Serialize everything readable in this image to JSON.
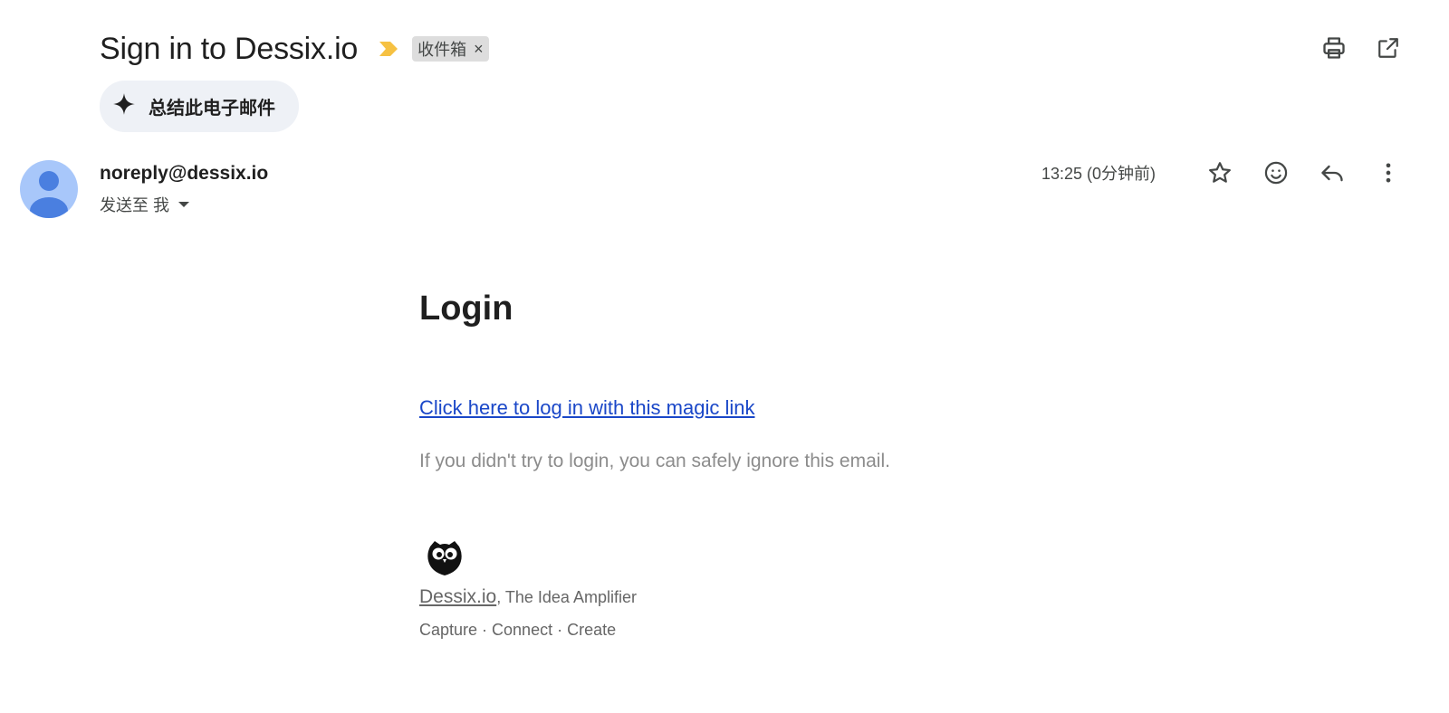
{
  "email": {
    "subject": "Sign in to Dessix.io",
    "label_chip": "收件箱",
    "label_close": "×",
    "summarize_label": "总结此电子邮件",
    "sender": "noreply@dessix.io",
    "recipient": "发送至 我",
    "timestamp": "13:25 (0分钟前)"
  },
  "icons": {
    "importance": "importance-marker-icon",
    "print": "print-icon",
    "open_new_window": "open-in-new-window-icon",
    "sparkle": "sparkle-icon",
    "avatar": "person-icon",
    "star": "star-icon",
    "emoji": "emoji-icon",
    "reply": "reply-icon",
    "more": "more-vert-icon",
    "owl": "owl-logo"
  },
  "colors": {
    "importance": "#f6c142",
    "avatar_bg": "#a8c7fa",
    "avatar_fg": "#4a7fe0",
    "link": "#1a47c8",
    "chip_bg": "#dddddd",
    "summarize_bg": "#eef1f6"
  },
  "content": {
    "heading": "Login",
    "magic_link": "Click here to log in with this magic link",
    "ignore_note": "If you didn't try to login, you can safely ignore this email.",
    "brand_link": "Dessix.io",
    "brand_suffix": ", The Idea Amplifier",
    "tagline": "Capture · Connect · Create"
  }
}
